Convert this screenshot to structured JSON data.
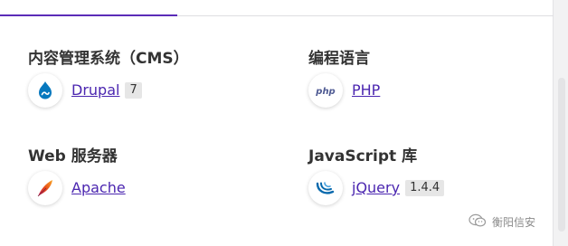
{
  "sections": {
    "cms": {
      "title": "内容管理系统（CMS）",
      "tech": {
        "name": "Drupal",
        "version": "7",
        "icon": "drupal-icon"
      }
    },
    "programming_languages": {
      "title": "编程语言",
      "tech": {
        "name": "PHP",
        "icon": "php-icon"
      }
    },
    "web_servers": {
      "title": "Web 服务器",
      "tech": {
        "name": "Apache",
        "icon": "apache-feather-icon"
      }
    },
    "javascript_libraries": {
      "title": "JavaScript 库",
      "tech": {
        "name": "jQuery",
        "version": "1.4.4",
        "icon": "jquery-icon"
      }
    }
  },
  "watermark": {
    "text": "衡阳信安",
    "icon": "wechat-icon"
  },
  "colors": {
    "link": "#4b26b0",
    "active_tab": "#5b2bb8",
    "drupal": "#0678be",
    "php": "#4f5b93",
    "jquery": "#0769ad",
    "badge_bg": "#e6e6e6"
  }
}
